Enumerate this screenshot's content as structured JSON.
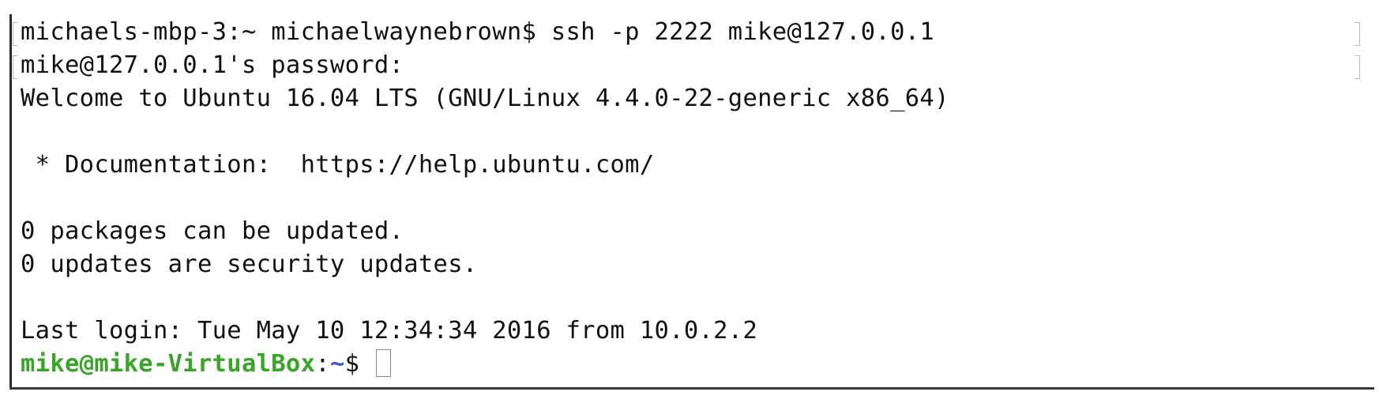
{
  "terminal": {
    "lines": [
      "michaels-mbp-3:~ michaelwaynebrown$ ssh -p 2222 mike@127.0.0.1",
      "mike@127.0.0.1's password:",
      "Welcome to Ubuntu 16.04 LTS (GNU/Linux 4.4.0-22-generic x86_64)",
      "",
      " * Documentation:  https://help.ubuntu.com/",
      "",
      "0 packages can be updated.",
      "0 updates are security updates.",
      "",
      "Last login: Tue May 10 12:34:34 2016 from 10.0.2.2"
    ],
    "prompt": {
      "user_host": "mike@mike-VirtualBox",
      "separator": ":",
      "path": "~",
      "symbol": "$ "
    }
  },
  "colors": {
    "prompt_user_host": "#3aa32a",
    "prompt_path": "#3a5bc7",
    "text": "#111111",
    "background": "#ffffff"
  }
}
